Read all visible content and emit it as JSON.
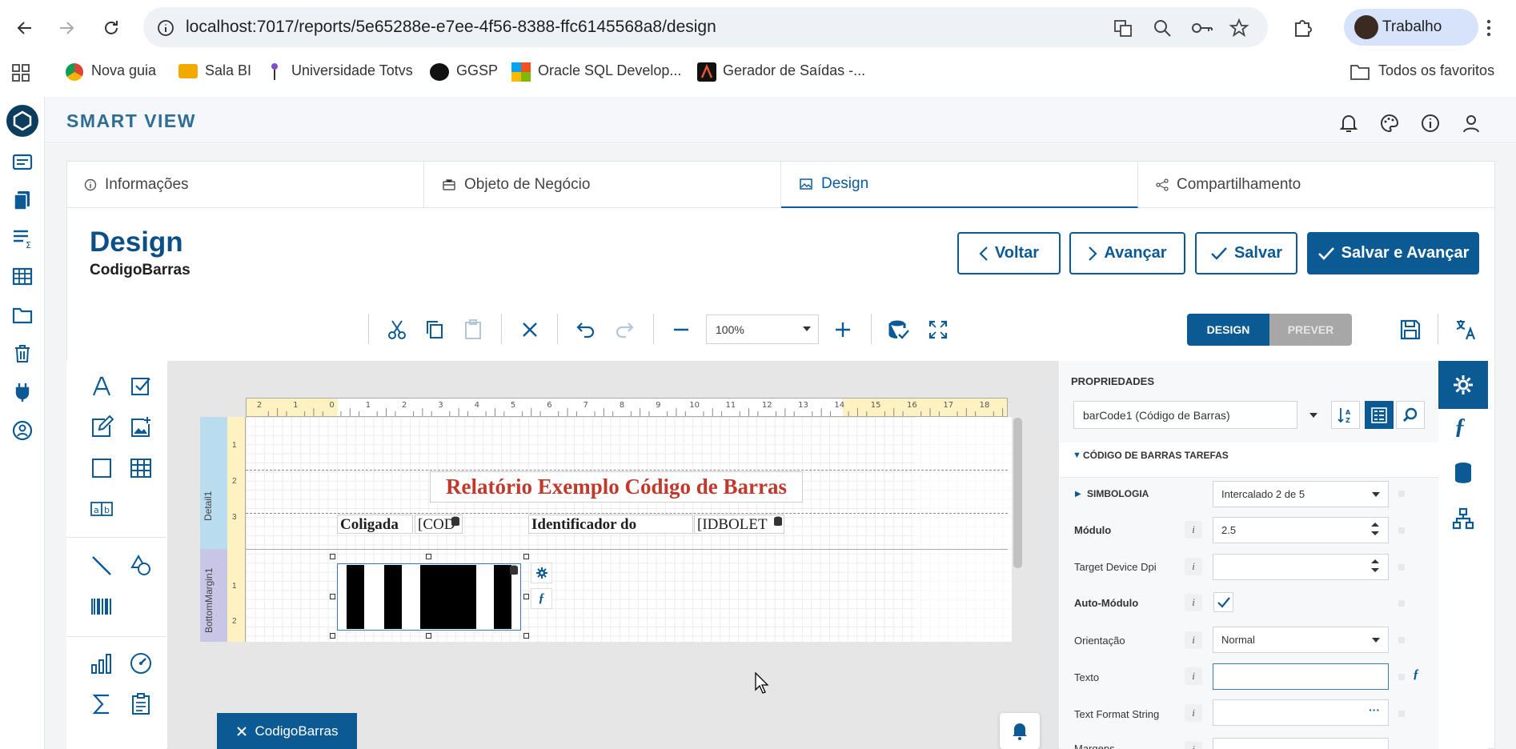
{
  "browser": {
    "url": "localhost:7017/reports/5e65288e-e7ee-4f56-8388-ffc6145568a8/design",
    "profile_name": "Trabalho",
    "bookmarks": [
      "Nova guia",
      "Sala BI",
      "Universidade Totvs",
      "GGSP",
      "Oracle SQL Develop...",
      "Gerador de Saídas -..."
    ],
    "all_bookmarks": "Todos os favoritos"
  },
  "app": {
    "title": "SMART VIEW"
  },
  "tabs": [
    {
      "label": "Informações"
    },
    {
      "label": "Objeto de Negócio"
    },
    {
      "label": "Design"
    },
    {
      "label": "Compartilhamento"
    }
  ],
  "page": {
    "title": "Design",
    "subtitle": "CodigoBarras"
  },
  "actions": {
    "back": "Voltar",
    "next": "Avançar",
    "save": "Salvar",
    "save_next": "Salvar e Avançar"
  },
  "toolbar": {
    "zoom": "100%",
    "mode_design": "DESIGN",
    "mode_preview": "PREVER"
  },
  "designer": {
    "ruler_labels": [
      "2",
      "1",
      "0",
      "1",
      "2",
      "3",
      "4",
      "5",
      "6",
      "7",
      "8",
      "9",
      "10",
      "11",
      "12",
      "13",
      "14",
      "15",
      "16",
      "17",
      "18"
    ],
    "band_detail": "Detail1",
    "band_bottom": "BottomMargin1",
    "report_title": "Relatório Exemplo Código de Barras",
    "label_coligada": "Coligada",
    "field_cod": "[COD",
    "label_identificador": "Identificador do",
    "field_idbolet": "[IDBOLET",
    "footer_tab": "CodigoBarras"
  },
  "properties": {
    "title": "PROPRIEDADES",
    "selected_component": "barCode1 (Código de Barras)",
    "section": "CÓDIGO DE BARRAS TAREFAS",
    "rows": [
      {
        "label": "SIMBOLOGIA",
        "value": "Intercalado 2 de 5"
      },
      {
        "label": "Módulo",
        "value": "2.5"
      },
      {
        "label": "Target Device Dpi",
        "value": ""
      },
      {
        "label": "Auto-Módulo",
        "value": ""
      },
      {
        "label": "Orientação",
        "value": "Normal"
      },
      {
        "label": "Texto",
        "value": ""
      },
      {
        "label": "Text Format String",
        "value": ""
      },
      {
        "label": "Margens",
        "value": ""
      }
    ]
  },
  "colors": {
    "primary": "#0c5a93",
    "report_title": "#c0392b"
  }
}
